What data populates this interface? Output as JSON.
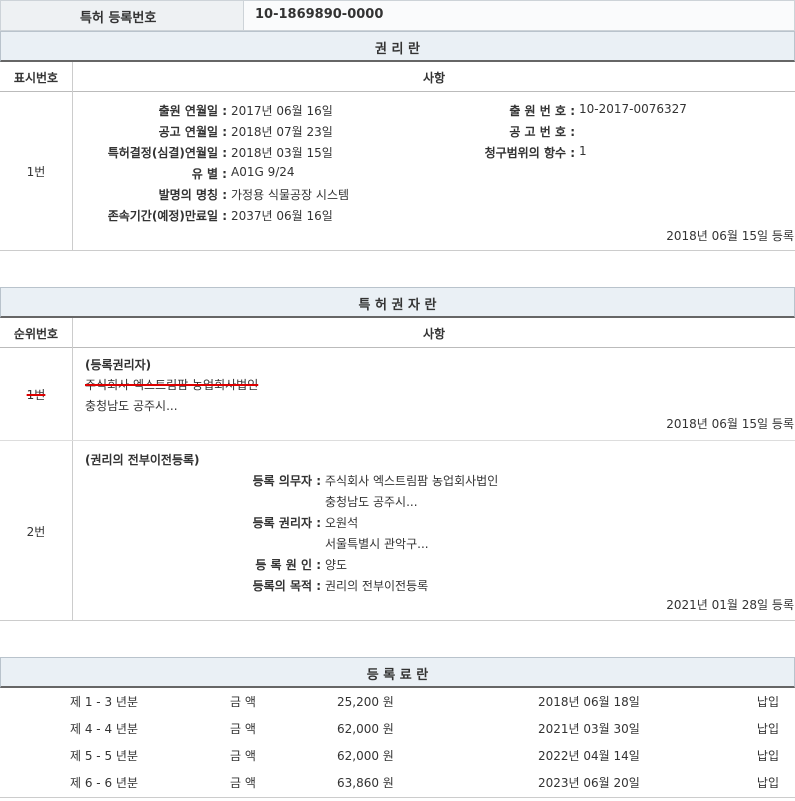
{
  "reg_number": {
    "label": "특허 등록번호",
    "value": "10-1869890-0000"
  },
  "rights": {
    "title": "권 리 란",
    "col_index": "표시번호",
    "col_content": "사항",
    "entry": {
      "index": "1번",
      "left_labels": [
        "출원 연월일 :",
        "공고 연월일 :",
        "특허결정(심결)연월일 :",
        "유 별 :",
        "발명의 명칭 :",
        "존속기간(예정)만료일 :"
      ],
      "left_values": [
        "2017년 06월 16일",
        "2018년 07월 23일",
        "2018년 03월 15일",
        "A01G 9/24",
        "가정용 식물공장 시스템",
        "2037년 06월 16일"
      ],
      "right_labels": [
        "출 원 번 호 :",
        "공 고 번 호 :",
        "청구범위의 항수 :"
      ],
      "right_values": [
        "10-2017-0076327",
        "",
        "1"
      ],
      "reg_date": "2018년 06월 15일 등록"
    }
  },
  "holders": {
    "title": "특 허 권 자 란",
    "col_index": "순위번호",
    "col_content": "사항",
    "entry1": {
      "index": "1번",
      "heading": "(등록권리자)",
      "name": "주식회사 엑스트림팜 농업회사법인",
      "address": "충청남도 공주시...",
      "reg_date": "2018년 06월 15일 등록"
    },
    "entry2": {
      "index": "2번",
      "heading": "(권리의 전부이전등록)",
      "labels": [
        "등록 의무자 :",
        "",
        "등록 권리자 :",
        "",
        "등 록 원 인 :",
        "등록의 목적 :"
      ],
      "values": [
        "주식회사 엑스트림팜 농업회사법인",
        "충청남도 공주시...",
        "오원석",
        "서울특별시 관악구...",
        "양도",
        "권리의 전부이전등록"
      ],
      "reg_date": "2021년 01월 28일 등록"
    }
  },
  "fees": {
    "title": "등 록 료 란",
    "rows": [
      {
        "period": "제 1 - 3 년분",
        "label": "금 액",
        "amount": "25,200 원",
        "date": "2018년 06월 18일",
        "status": "납입"
      },
      {
        "period": "제 4 - 4 년분",
        "label": "금 액",
        "amount": "62,000 원",
        "date": "2021년 03월 30일",
        "status": "납입"
      },
      {
        "period": "제 5 - 5 년분",
        "label": "금 액",
        "amount": "62,000 원",
        "date": "2022년 04월 14일",
        "status": "납입"
      },
      {
        "period": "제 6 - 6 년분",
        "label": "금 액",
        "amount": "63,860 원",
        "date": "2023년 06월 20일",
        "status": "납입"
      }
    ]
  }
}
